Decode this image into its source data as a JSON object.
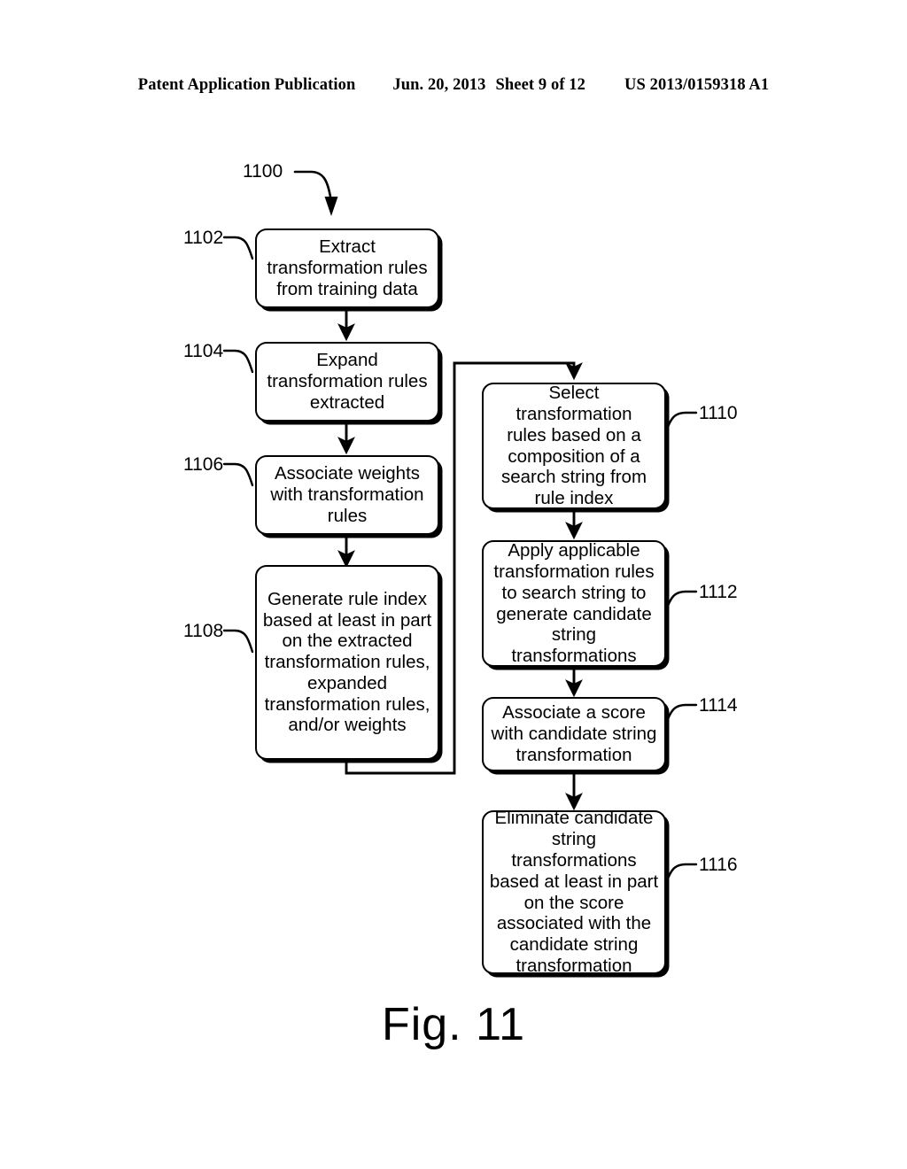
{
  "header": {
    "publication": "Patent Application Publication",
    "date": "Jun. 20, 2013",
    "sheet": "Sheet 9 of 12",
    "patent_number": "US 2013/0159318 A1"
  },
  "figure": {
    "caption": "Fig. 11",
    "diagram_reference": "1100"
  },
  "nodes": [
    {
      "ref": "1102",
      "text": "Extract\ntransformation rules\nfrom training data"
    },
    {
      "ref": "1104",
      "text": "Expand\ntransformation rules\nextracted"
    },
    {
      "ref": "1106",
      "text": "Associate weights\nwith transformation\nrules"
    },
    {
      "ref": "1108",
      "text": "Generate rule index\nbased at least in part\non the extracted\ntransformation rules,\nexpanded\ntransformation rules,\nand/or weights"
    },
    {
      "ref": "1110",
      "text": "Select transformation\nrules based on a\ncomposition of a\nsearch string from\nrule index"
    },
    {
      "ref": "1112",
      "text": "Apply applicable\ntransformation rules\nto search string to\ngenerate candidate\nstring transformations"
    },
    {
      "ref": "1114",
      "text": "Associate a score\nwith candidate string\ntransformation"
    },
    {
      "ref": "1116",
      "text": "Eliminate candidate\nstring transformations\nbased at least in part\non the score\nassociated with the\ncandidate string\ntransformation"
    }
  ],
  "colors": {
    "ink": "#000000",
    "paper": "#ffffff"
  }
}
